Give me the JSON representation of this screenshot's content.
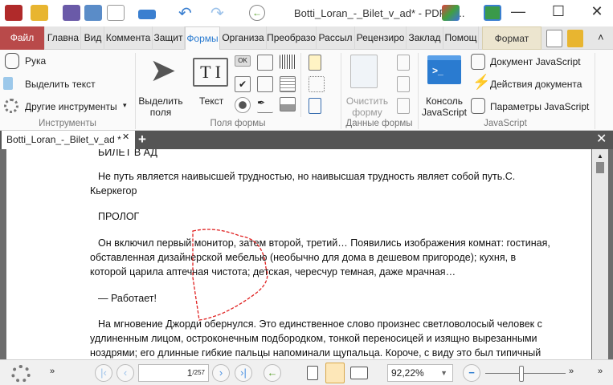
{
  "title": "Botti_Loran_-_Bilet_v_ad* - PDF-X...",
  "ribbon_tabs": [
    "Файл",
    "Главна",
    "Вид",
    "Коммента",
    "Защит",
    "Формы",
    "Организа",
    "Преобразо",
    "Рассыл",
    "Рецензиро",
    "Заклад",
    "Помощ",
    "Формат"
  ],
  "tools": {
    "hand": "Рука",
    "select_text": "Выделить текст",
    "other_tools": "Другие инструменты",
    "group": "Инструменты"
  },
  "form_fields": {
    "select_fields": "Выделить поля",
    "text": "Текст",
    "ok": "OK",
    "group": "Поля формы"
  },
  "form_data": {
    "clear": "Очистить форму",
    "group": "Данные формы"
  },
  "javascript": {
    "console": "Консоль JavaScript",
    "doc_js": "Документ JavaScript",
    "doc_actions": "Действия документа",
    "js_params": "Параметры JavaScript",
    "group": "JavaScript"
  },
  "doc_tab": "Botti_Loran_-_Bilet_v_ad *",
  "document_lines": [
    "БИЛЕТ В АД",
    "Не путь является наивысшей трудностью, но наивысшая трудность являет собой путь.С.",
    "Кьеркегор",
    "ПРОЛОГ",
    "Он включил первый монитор, затем второй, третий… Появились изображения комнат: гостиная,",
    "обставленная дизайнерской мебелью (необычно для дома в дешевом пригороде); кухня, в",
    "которой царила аптечная чистота; детская, чересчур темная, даже мрачная…",
    "— Работает!",
    "На мгновение Джорди обернулся. Это единственное слово произнес светловолосый человек с",
    "удлиненным лицом, остроконечным подбородком, тонкой переносицей и изящно вырезанными",
    "ноздрями; его длинные гибкие пальцы напоминали щупальца. Короче, с виду это был типичный"
  ],
  "status": {
    "page_current": "1",
    "page_total": "/257",
    "zoom": "92,22%",
    "zoom_slider": 0.5
  }
}
